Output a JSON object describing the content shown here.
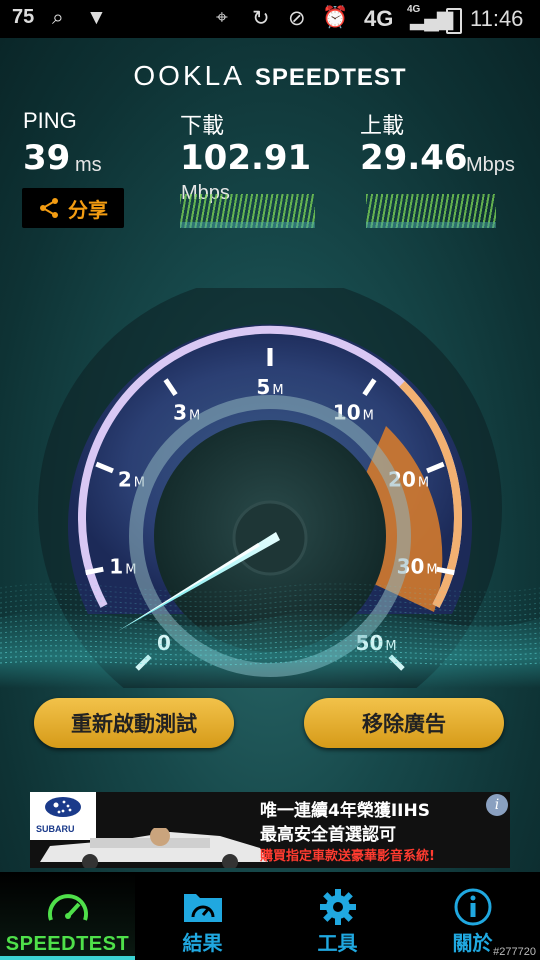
{
  "status_bar": {
    "left_number": "75",
    "time": "11:46",
    "network": "4G",
    "network_small": "4G"
  },
  "brand": {
    "ookla": "OOKLA",
    "speedtest": "SPEEDTEST"
  },
  "ping": {
    "label": "PING",
    "value": "39",
    "unit": "ms"
  },
  "download": {
    "label": "下載",
    "value": "102.91",
    "unit": "Mbps"
  },
  "upload": {
    "label": "上載",
    "value": "29.46",
    "unit": "Mbps"
  },
  "share": {
    "label": "分享"
  },
  "gauge": {
    "ticks": [
      "0",
      "1M",
      "2M",
      "3M",
      "5M",
      "10M",
      "20M",
      "30M",
      "50M"
    ],
    "tick_numbers": [
      "0",
      "1",
      "2",
      "3",
      "5",
      "10",
      "20",
      "30",
      "50"
    ],
    "tick_suffix": "M"
  },
  "buttons": {
    "restart": "重新啟動測試",
    "remove_ads": "移除廣告"
  },
  "ad": {
    "line1": "唯一連續4年榮獲IIHS",
    "line2": "最高安全首選認可",
    "line3": "購買指定車款送豪華影音系統!",
    "brand": "SUBARU"
  },
  "nav": {
    "items": [
      {
        "label": "SPEEDTEST",
        "icon": "speedometer-icon",
        "active": true
      },
      {
        "label": "結果",
        "icon": "folder-gauge-icon",
        "active": false
      },
      {
        "label": "工具",
        "icon": "gear-icon",
        "active": false
      },
      {
        "label": "關於",
        "icon": "info-icon",
        "active": false
      }
    ]
  },
  "watermark": "#277720",
  "colors": {
    "accent_green": "#4fe04a",
    "accent_blue": "#20a8e0",
    "share_orange": "#f39c12",
    "button_gold": "#e3ab2b"
  }
}
